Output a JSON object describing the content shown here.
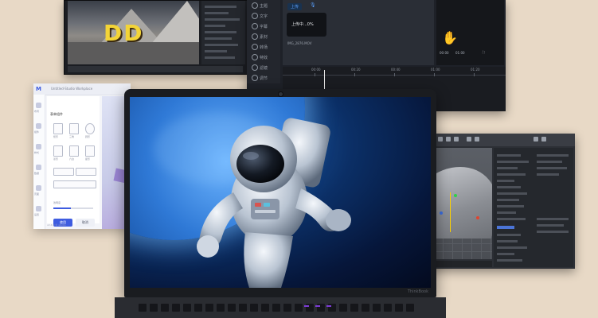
{
  "background_color": "#e8d9c6",
  "video_editor": {
    "chip_label": "上传",
    "mic_icon": "mic-icon",
    "toast_text": "上传中...0%",
    "file_name": "IMG_2876.MOV",
    "sidebar_items": [
      "主题",
      "文字",
      "字幕",
      "素材",
      "转场",
      "特效",
      "滤镜",
      "调节"
    ],
    "timestamps": [
      "00:00",
      "01:00"
    ],
    "timeline_labels": [
      "00:00",
      "00:20",
      "00:40",
      "01:00",
      "01:20"
    ],
    "gesture_icon": "hand-gesture-icon"
  },
  "form_editor": {
    "logo_text": "M",
    "window_title": "Untitled-Studio Workplace",
    "panel_title": "表单组件",
    "sidebar_labels": [
      "布局",
      "组件",
      "样式",
      "数据",
      "页面",
      "设置"
    ],
    "shape_labels": [
      "矩形",
      "三角",
      "圆形",
      "菱形",
      "六边",
      "星形"
    ],
    "slider_label": "透明度",
    "primary_button": "使用",
    "secondary_button": "取消",
    "footer_text": "v2.4.0 © studio"
  },
  "laptop": {
    "brand_text": "ThinkBook"
  },
  "colors": {
    "accent_blue": "#3e5ce0",
    "video_accent": "#5aa0ff",
    "keyboard_accent": "#7d3bd6",
    "gizmo_yellow": "#ffd400",
    "gizmo_green": "#2fd14a",
    "gizmo_red": "#e0452f",
    "gizmo_blue": "#3b6fe0"
  }
}
